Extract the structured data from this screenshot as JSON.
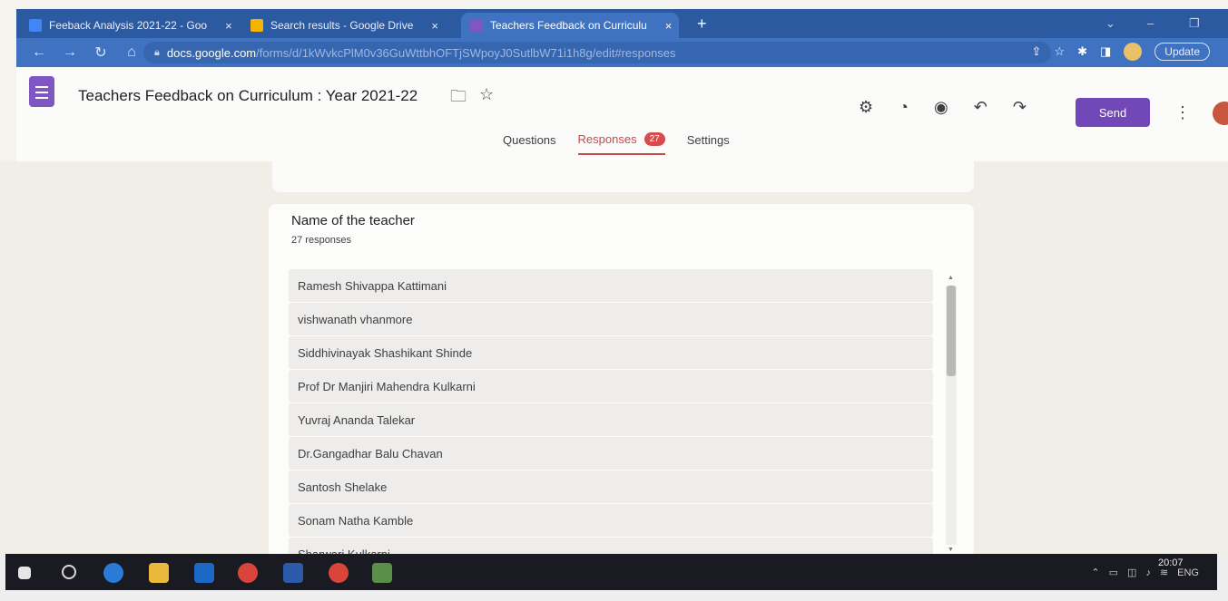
{
  "browser": {
    "tabs": [
      {
        "label": "Feeback Analysis 2021-22 - Goo",
        "icon_color": "#4285f4"
      },
      {
        "label": "Search results - Google Drive",
        "icon_color": "#f4b400"
      },
      {
        "label": "Teachers Feedback on Curriculu",
        "icon_color": "#7e57c2"
      }
    ],
    "new_tab": "+",
    "url_host": "docs.google.com",
    "url_path": "/forms/d/1kWvkcPlM0v36GuWttbhOFTjSWpoyJ0SutlbW71i1h8g/edit#responses",
    "update_label": "Update"
  },
  "forms": {
    "title": "Teachers Feedback on Curriculum  : Year 2021-22",
    "send_label": "Send",
    "tabs": [
      {
        "label": "Questions"
      },
      {
        "label": "Responses",
        "badge": "27"
      },
      {
        "label": "Settings"
      }
    ]
  },
  "question": {
    "title": "Name of the teacher",
    "count": "27 responses",
    "responses": [
      "Ramesh Shivappa Kattimani",
      "vishwanath vhanmore",
      "Siddhivinayak Shashikant Shinde",
      "Prof Dr Manjiri Mahendra Kulkarni",
      "Yuvraj Ananda Talekar",
      "Dr.Gangadhar Balu Chavan",
      "Santosh Shelake",
      "Sonam Natha Kamble",
      "Sharwari Kulkarni"
    ],
    "scroll_position": 0.0
  },
  "taskbar": {
    "tray_lang": "ENG",
    "clock": "20:07"
  },
  "colors": {
    "accent": "#7248b9",
    "responses_active": "#c54a4a",
    "chrome_tabstrip": "#2c5aa0"
  }
}
